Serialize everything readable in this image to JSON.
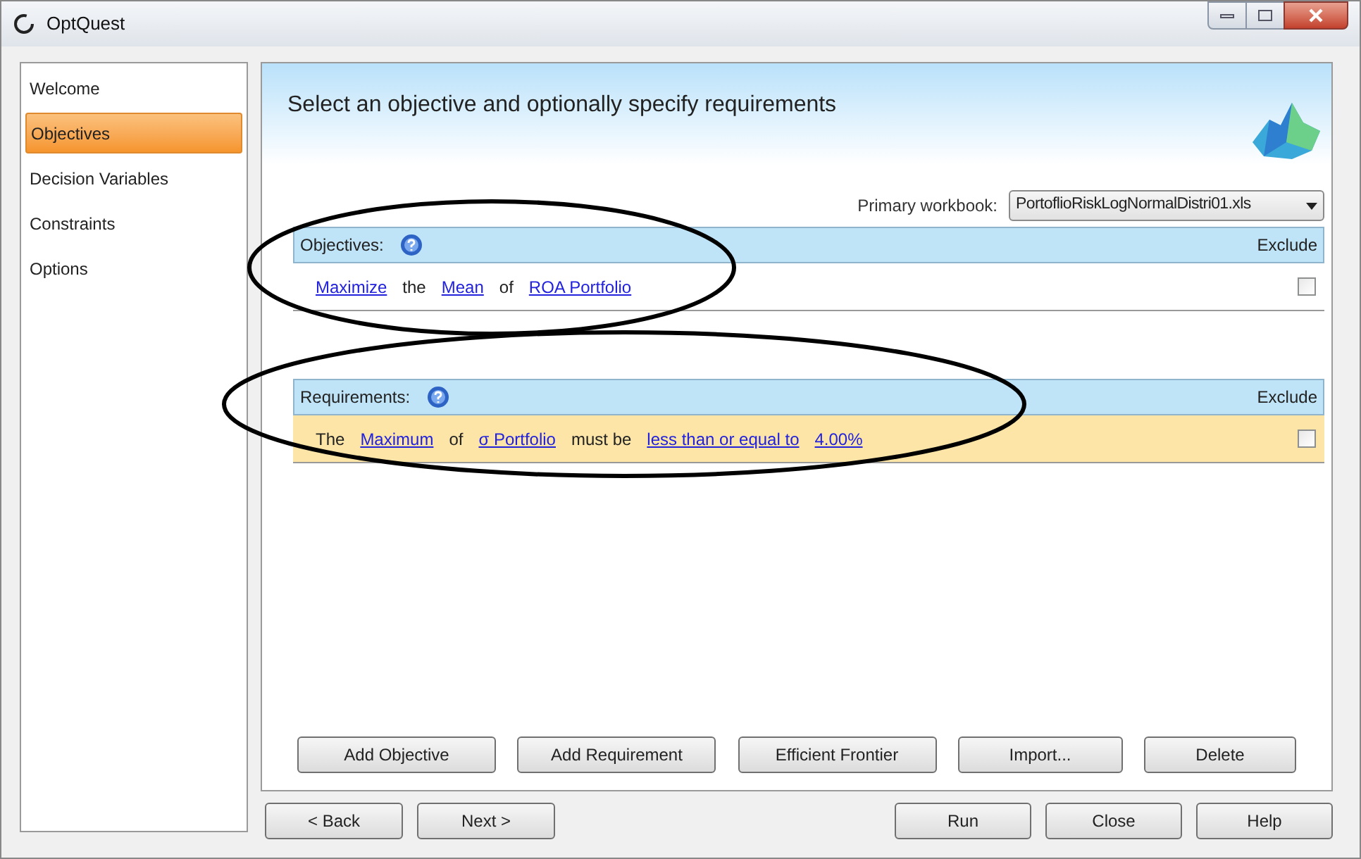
{
  "window": {
    "title": "OptQuest"
  },
  "sidebar": {
    "items": [
      {
        "label": "Welcome",
        "selected": false
      },
      {
        "label": "Objectives",
        "selected": true
      },
      {
        "label": "Decision Variables",
        "selected": false
      },
      {
        "label": "Constraints",
        "selected": false
      },
      {
        "label": "Options",
        "selected": false
      }
    ]
  },
  "header": {
    "title": "Select an objective and optionally specify requirements"
  },
  "primary_workbook": {
    "label": "Primary workbook:",
    "value": "PortoflioRiskLogNormalDistri01.xls"
  },
  "sections": [
    {
      "heading": "Objectives:",
      "exclude_label": "Exclude",
      "rows": [
        {
          "selected": false,
          "excluded": false,
          "parts": [
            {
              "text": "Maximize",
              "kind": "link"
            },
            {
              "text": "the",
              "kind": "text"
            },
            {
              "text": "Mean",
              "kind": "link"
            },
            {
              "text": "of",
              "kind": "text"
            },
            {
              "text": "ROA Portfolio",
              "kind": "link"
            }
          ]
        }
      ]
    },
    {
      "heading": "Requirements:",
      "exclude_label": "Exclude",
      "rows": [
        {
          "selected": true,
          "excluded": false,
          "parts": [
            {
              "text": "The",
              "kind": "text"
            },
            {
              "text": "Maximum",
              "kind": "link"
            },
            {
              "text": "of",
              "kind": "text"
            },
            {
              "text": "σ Portfolio",
              "kind": "link"
            },
            {
              "text": "must be",
              "kind": "text"
            },
            {
              "text": "less than or equal to",
              "kind": "link"
            },
            {
              "text": "4.00%",
              "kind": "link"
            }
          ]
        }
      ]
    }
  ],
  "action_buttons": [
    "Add Objective",
    "Add Requirement",
    "Efficient Frontier",
    "Import...",
    "Delete"
  ],
  "nav_buttons": [
    "< Back",
    "Next >"
  ],
  "dialog_buttons": [
    "Run",
    "Close",
    "Help"
  ]
}
